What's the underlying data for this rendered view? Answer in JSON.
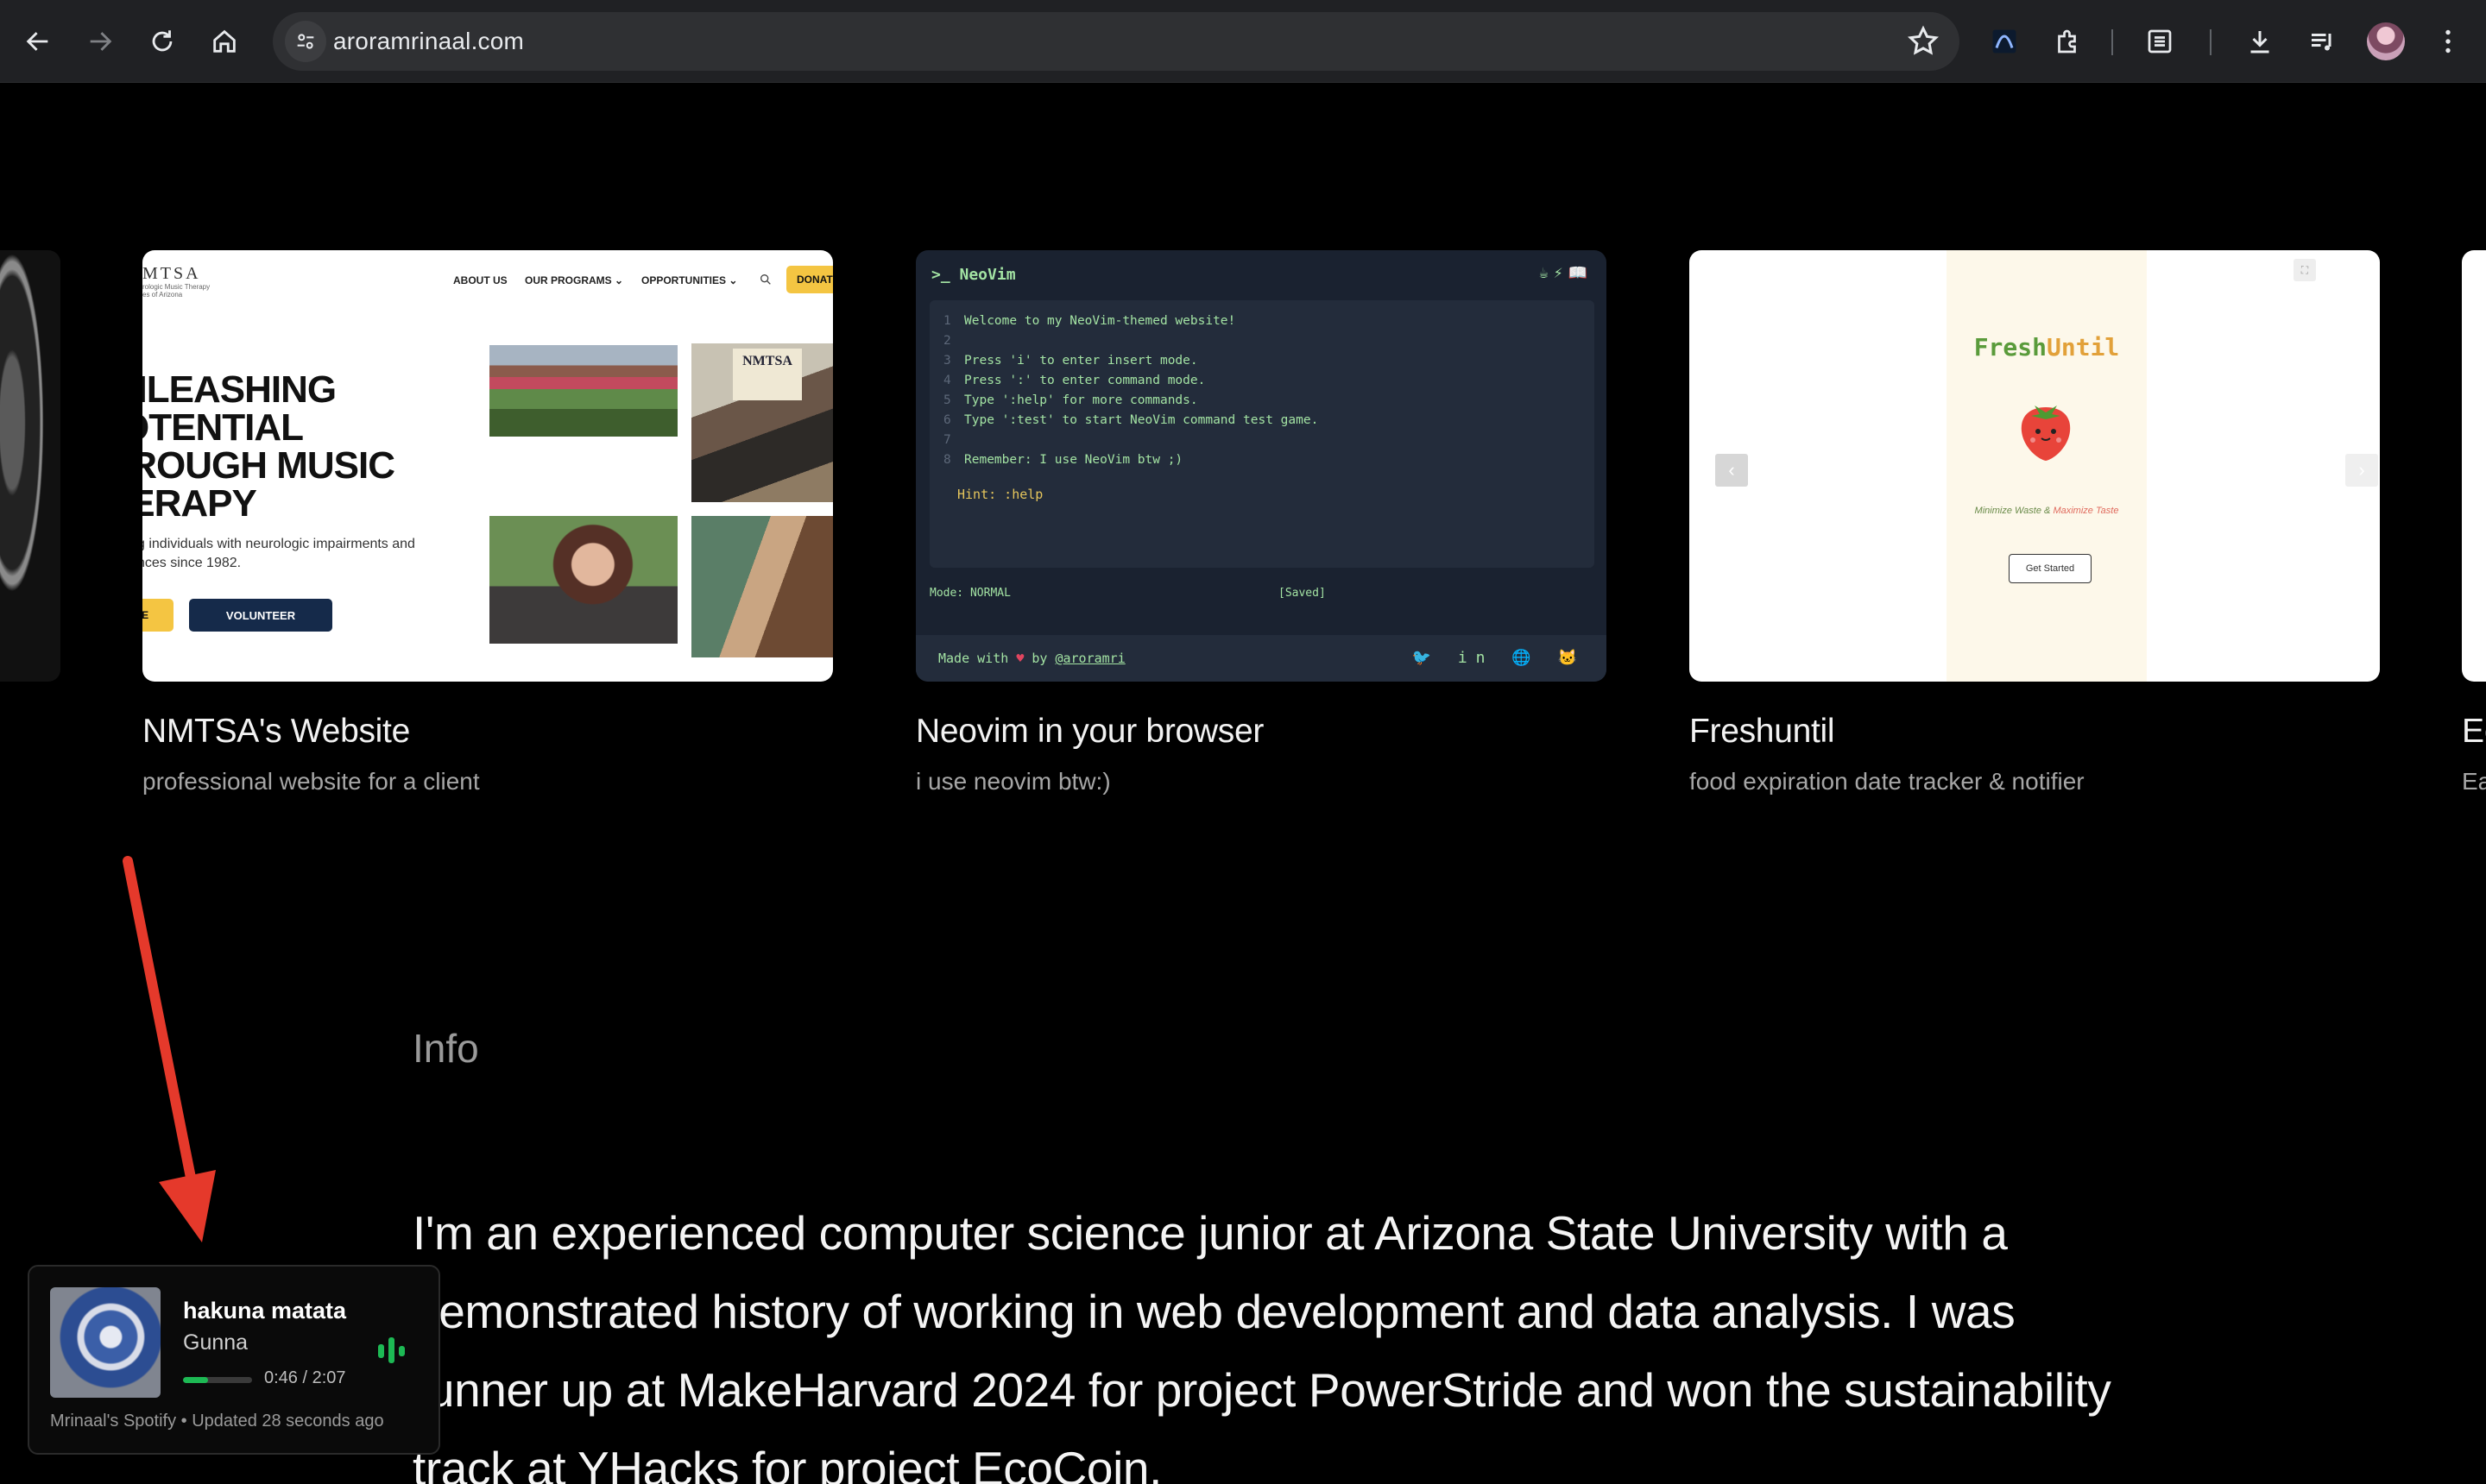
{
  "browser": {
    "url": "aroramrinaal.com",
    "nav_icons": [
      "back-icon",
      "forward-icon",
      "reload-icon",
      "home-icon"
    ],
    "toolbar_icons": [
      "extension-app-icon",
      "puzzle-icon",
      "reading-list-icon",
      "download-icon",
      "media-control-icon",
      "profile-avatar",
      "kebab-menu-icon"
    ]
  },
  "projects": [
    {
      "title": "NMTSA's Website",
      "description": "professional website for a client",
      "preview": {
        "logo": "MTSA",
        "logo_sub": "rologic Music Therapy\nes of Arizona",
        "menu": [
          "ABOUT US",
          "OUR PROGRAMS ⌄",
          "OPPORTUNITIES ⌄"
        ],
        "donate": "DONAT",
        "headline": [
          "NLEASHING",
          "OTENTIAL",
          "IROUGH MUSIC",
          "IERAPY"
        ],
        "sub": "g individuals with neurologic impairments and\nnces since 1982.",
        "btn_partial": "ATE",
        "btn_volunteer": "VOLUNTEER",
        "poster_text": "NMTSA"
      }
    },
    {
      "title": "Neovim in your browser",
      "description": "i use neovim btw:)",
      "preview": {
        "header": ">_ NeoVim",
        "header_icons": "☕⚡📖",
        "lines": [
          {
            "num": "1",
            "text": "Welcome to my NeoVim-themed website!"
          },
          {
            "num": "2",
            "text": ""
          },
          {
            "num": "3",
            "text": "Press 'i' to enter insert mode."
          },
          {
            "num": "4",
            "text": "Press ':' to enter command mode."
          },
          {
            "num": "5",
            "text": "Type ':help' for more commands."
          },
          {
            "num": "6",
            "text": "Type ':test' to start NeoVim command test game."
          },
          {
            "num": "7",
            "text": ""
          },
          {
            "num": "8",
            "text": "Remember: I use NeoVim btw ;)"
          }
        ],
        "hint": "Hint: :help",
        "mode": "Mode: NORMAL",
        "saved": "[Saved]",
        "made_with": "Made with",
        "heart": "♥",
        "by": "by",
        "handle": "@aroramri",
        "social": "🐦 in 🌐 🐱"
      }
    },
    {
      "title": "Freshuntil",
      "description": "food expiration date tracker & notifier",
      "preview": {
        "brand_a": "Fresh",
        "brand_b": "Until",
        "tag_a": "Minimize Waste &",
        "tag_b": "Maximize Taste",
        "cta": "Get Started",
        "prev": "‹",
        "next": "›",
        "fullscreen": "⛶"
      }
    },
    {
      "title": "Ec",
      "description": "Ea"
    }
  ],
  "info": {
    "heading": "Info",
    "paragraph": "I'm an experienced computer science junior at Arizona State University with a demonstrated history of working in web development and data analysis. I was runner up at MakeHarvard 2024 for project PowerStride and won the sustainability track at YHacks for project EcoCoin."
  },
  "spotify": {
    "song": "hakuna matata",
    "artist": "Gunna",
    "time": "0:46 / 2:07",
    "progress": 0.36,
    "footer": "Mrinaal's Spotify • Updated 28 seconds ago",
    "accent": "#1db954"
  },
  "annotation": {
    "arrow_color": "#e5392b"
  }
}
